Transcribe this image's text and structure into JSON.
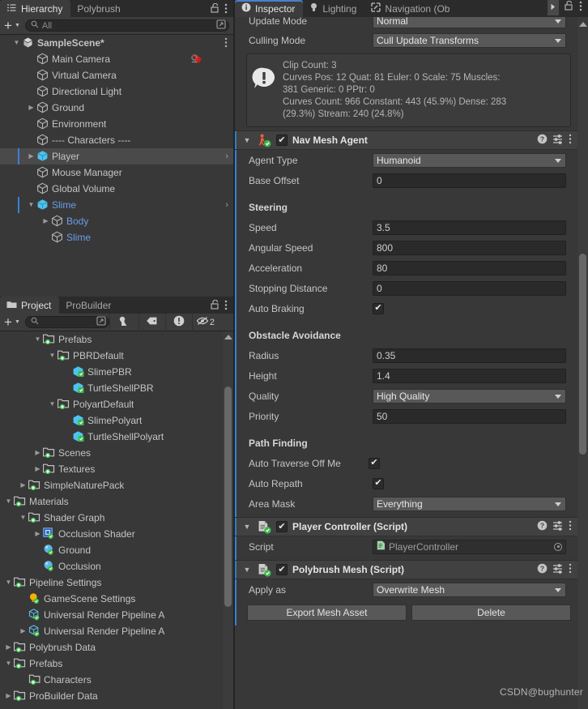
{
  "hierarchy": {
    "tabs": [
      {
        "label": "Hierarchy",
        "icon": "hierarchy-icon",
        "active": true
      },
      {
        "label": "Polybrush",
        "icon": "",
        "active": false
      }
    ],
    "toolbar": {
      "add_label": "+",
      "dropdown_caret": "▾",
      "search_placeholder": "All",
      "search_value": "",
      "search_icon": "search-icon",
      "filter_icon": "filter-window-icon"
    },
    "items": [
      {
        "label": "SampleScene*",
        "depth": 0,
        "twisty": "down",
        "icon": "unity-scene-icon",
        "bold": true,
        "kebab": true
      },
      {
        "label": "Main Camera",
        "depth": 1,
        "twisty": "",
        "icon": "gameobject-icon",
        "badge": "audio-listener-warning-icon"
      },
      {
        "label": "Virtual Camera",
        "depth": 1,
        "twisty": "",
        "icon": "gameobject-icon"
      },
      {
        "label": "Directional Light",
        "depth": 1,
        "twisty": "",
        "icon": "gameobject-icon"
      },
      {
        "label": "Ground",
        "depth": 1,
        "twisty": "right",
        "icon": "gameobject-icon"
      },
      {
        "label": "Environment",
        "depth": 1,
        "twisty": "",
        "icon": "gameobject-icon"
      },
      {
        "label": "---- Characters ----",
        "depth": 1,
        "twisty": "",
        "icon": "gameobject-icon"
      },
      {
        "label": "Player",
        "depth": 1,
        "twisty": "right",
        "icon": "prefab-icon",
        "selected": true,
        "chevron": true
      },
      {
        "label": "Mouse Manager",
        "depth": 1,
        "twisty": "",
        "icon": "gameobject-icon"
      },
      {
        "label": "Global Volume",
        "depth": 1,
        "twisty": "",
        "icon": "gameobject-icon"
      },
      {
        "label": "Slime",
        "depth": 1,
        "twisty": "down",
        "icon": "prefab-icon",
        "blue": true,
        "childsel": true,
        "chevron": true
      },
      {
        "label": "Body",
        "depth": 2,
        "twisty": "right",
        "icon": "gameobject-icon",
        "blue": true
      },
      {
        "label": "Slime",
        "depth": 2,
        "twisty": "",
        "icon": "gameobject-icon",
        "blue": true
      }
    ]
  },
  "project": {
    "tabs": [
      {
        "label": "Project",
        "icon": "folder-icon",
        "active": true
      },
      {
        "label": "ProBuilder",
        "icon": "",
        "active": false
      }
    ],
    "toolbar": {
      "add_label": "+",
      "dropdown_caret": "▾",
      "search_value": "",
      "search_icon": "search-icon",
      "buttons": [
        "asset-pipeline-icon",
        "label-tag-icon",
        "console-warning-icon",
        "hidden-eye-icon"
      ],
      "hidden_count": "2"
    },
    "items": [
      {
        "label": "Prefabs",
        "depth": 2,
        "twisty": "down",
        "icon": "folder-plus-icon"
      },
      {
        "label": "PBRDefault",
        "depth": 3,
        "twisty": "down",
        "icon": "folder-plus-icon"
      },
      {
        "label": "SlimePBR",
        "depth": 4,
        "twisty": "",
        "icon": "prefab-asset-icon"
      },
      {
        "label": "TurtleShellPBR",
        "depth": 4,
        "twisty": "",
        "icon": "prefab-asset-icon"
      },
      {
        "label": "PolyartDefault",
        "depth": 3,
        "twisty": "down",
        "icon": "folder-plus-icon"
      },
      {
        "label": "SlimePolyart",
        "depth": 4,
        "twisty": "",
        "icon": "prefab-asset-icon"
      },
      {
        "label": "TurtleShellPolyart",
        "depth": 4,
        "twisty": "",
        "icon": "prefab-asset-icon"
      },
      {
        "label": "Scenes",
        "depth": 2,
        "twisty": "right",
        "icon": "folder-plus-icon"
      },
      {
        "label": "Textures",
        "depth": 2,
        "twisty": "right",
        "icon": "folder-plus-icon"
      },
      {
        "label": "SimpleNaturePack",
        "depth": 1,
        "twisty": "right",
        "icon": "folder-plus-icon"
      },
      {
        "label": "Materials",
        "depth": 0,
        "twisty": "down",
        "icon": "folder-plus-icon"
      },
      {
        "label": "Shader Graph",
        "depth": 1,
        "twisty": "down",
        "icon": "folder-plus-icon"
      },
      {
        "label": "Occlusion Shader",
        "depth": 2,
        "twisty": "right",
        "icon": "shadergraph-icon"
      },
      {
        "label": "Ground",
        "depth": 2,
        "twisty": "",
        "icon": "material-icon"
      },
      {
        "label": "Occlusion",
        "depth": 2,
        "twisty": "",
        "icon": "material-icon"
      },
      {
        "label": "Pipeline Settings",
        "depth": 0,
        "twisty": "down",
        "icon": "folder-plus-icon"
      },
      {
        "label": "GameScene Settings",
        "depth": 1,
        "twisty": "",
        "icon": "lightbulb-icon"
      },
      {
        "label": "Universal Render Pipeline A",
        "depth": 1,
        "twisty": "",
        "icon": "scriptable-object-icon"
      },
      {
        "label": "Universal Render Pipeline A",
        "depth": 1,
        "twisty": "right",
        "icon": "scriptable-object-icon"
      },
      {
        "label": "Polybrush Data",
        "depth": 0,
        "twisty": "right",
        "icon": "folder-plus-icon"
      },
      {
        "label": "Prefabs",
        "depth": 0,
        "twisty": "down",
        "icon": "folder-plus-icon"
      },
      {
        "label": "Characters",
        "depth": 1,
        "twisty": "",
        "icon": "folder-empty-icon"
      },
      {
        "label": "ProBuilder Data",
        "depth": 0,
        "twisty": "right",
        "icon": "folder-plus-icon"
      }
    ]
  },
  "inspector": {
    "tabs": [
      {
        "label": "Inspector",
        "icon": "info-icon",
        "active": true
      },
      {
        "label": "Lighting",
        "icon": "lightbulb-icon",
        "active": false
      },
      {
        "label": "Navigation (Ob",
        "icon": "navigation-icon",
        "active": false
      }
    ],
    "tab_overflow_icon": "chevron-right-icon",
    "lock_icon": "lock-open-icon",
    "kebab_icon": "kebab-menu-icon",
    "animator_tail": {
      "update_mode": {
        "label": "Update Mode",
        "value": "Normal"
      },
      "culling_mode": {
        "label": "Culling Mode",
        "value": "Cull Update Transforms"
      },
      "helpbox_icon": "warning-info-icon",
      "helpbox_lines": [
        "Clip Count: 3",
        "Curves Pos: 12 Quat: 81 Euler: 0 Scale: 75 Muscles:",
        "381 Generic: 0 PPtr: 0",
        "Curves Count: 966 Constant: 443 (45.9%) Dense: 283",
        "(29.3%) Stream: 240 (24.8%)"
      ]
    },
    "components": [
      {
        "title": "Nav Mesh Agent",
        "icon": "navmeshagent-icon",
        "enabled": true,
        "help_icon": "help-icon",
        "preset_icon": "preset-icon",
        "kebab_icon": "kebab-menu-icon",
        "fields": [
          {
            "kind": "dropdown",
            "label": "Agent Type",
            "value": "Humanoid"
          },
          {
            "kind": "text",
            "label": "Base Offset",
            "value": "0"
          },
          {
            "kind": "gap"
          },
          {
            "kind": "section",
            "label": "Steering"
          },
          {
            "kind": "text",
            "label": "Speed",
            "value": "3.5"
          },
          {
            "kind": "text",
            "label": "Angular Speed",
            "value": "800"
          },
          {
            "kind": "text",
            "label": "Acceleration",
            "value": "80"
          },
          {
            "kind": "text",
            "label": "Stopping Distance",
            "value": "0"
          },
          {
            "kind": "check",
            "label": "Auto Braking",
            "value": true
          },
          {
            "kind": "gap"
          },
          {
            "kind": "section",
            "label": "Obstacle Avoidance"
          },
          {
            "kind": "text",
            "label": "Radius",
            "value": "0.35"
          },
          {
            "kind": "text",
            "label": "Height",
            "value": "1.4"
          },
          {
            "kind": "dropdown",
            "label": "Quality",
            "value": "High Quality"
          },
          {
            "kind": "text",
            "label": "Priority",
            "value": "50"
          },
          {
            "kind": "gap"
          },
          {
            "kind": "section",
            "label": "Path Finding"
          },
          {
            "kind": "check",
            "label": "Auto Traverse Off Me",
            "value": true,
            "narrow": true
          },
          {
            "kind": "check",
            "label": "Auto Repath",
            "value": true
          },
          {
            "kind": "dropdown",
            "label": "Area Mask",
            "value": "Everything"
          }
        ]
      },
      {
        "title": "Player Controller (Script)",
        "icon": "script-icon",
        "enabled": true,
        "help_icon": "help-icon",
        "preset_icon": "preset-icon",
        "kebab_icon": "kebab-menu-icon",
        "fields": [
          {
            "kind": "object",
            "label": "Script",
            "value": "PlayerController",
            "value_icon": "cs-script-icon"
          }
        ]
      },
      {
        "title": "Polybrush Mesh (Script)",
        "icon": "script-icon",
        "enabled": true,
        "help_icon": "help-icon",
        "preset_icon": "preset-icon",
        "kebab_icon": "kebab-menu-icon",
        "fields": [
          {
            "kind": "dropdown",
            "label": "Apply as",
            "value": "Overwrite Mesh"
          }
        ],
        "buttons": [
          {
            "label": "Export Mesh Asset"
          },
          {
            "label": "Delete"
          }
        ]
      }
    ]
  },
  "watermark": "CSDN@bughunter",
  "colors": {
    "accent_blue": "#3a7fd5",
    "tab_accent": "#4b7fcf",
    "panel_bg": "#383838",
    "header_bg": "#414141",
    "field_bg": "#2a2a2a",
    "dropdown_bg": "#585858",
    "text": "#c4c4c4",
    "link_blue": "#6a9ee8",
    "prefab_blue": "#63c8f0",
    "folder_green": "#3dbb4b"
  }
}
